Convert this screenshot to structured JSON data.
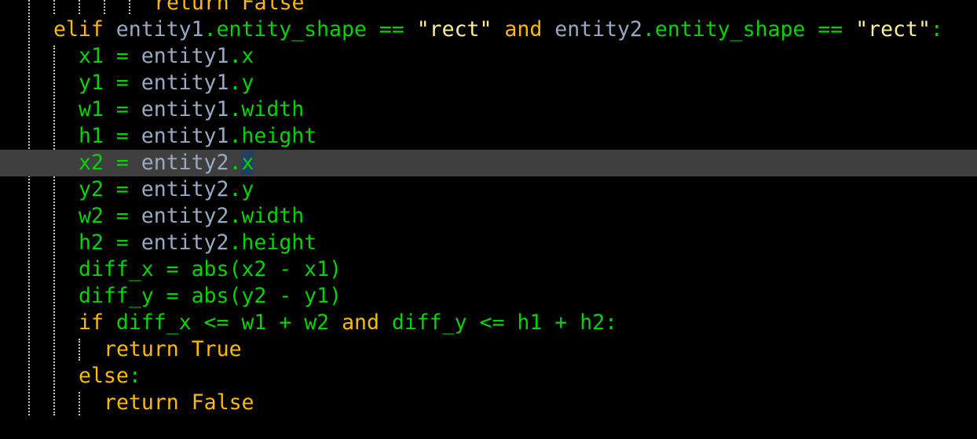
{
  "colors": {
    "background": "#000000",
    "current_line": "#3f3f3f",
    "keyword": "#ffb900",
    "identifier": "#98a9c2",
    "default": "#00d200",
    "string": "#ffee9c",
    "cursor": "#24405e"
  },
  "lines": [
    {
      "indent": 10,
      "current": false,
      "tokens": [
        {
          "t": "return",
          "c": "keyword"
        },
        {
          "t": " ",
          "c": "default"
        },
        {
          "t": "False",
          "c": "keyword"
        }
      ]
    },
    {
      "indent": 2,
      "current": false,
      "tokens": [
        {
          "t": "elif",
          "c": "keyword"
        },
        {
          "t": " ",
          "c": "default"
        },
        {
          "t": "entity1",
          "c": "identifier"
        },
        {
          "t": ".entity_shape == ",
          "c": "default"
        },
        {
          "t": "\"rect\"",
          "c": "string"
        },
        {
          "t": " ",
          "c": "default"
        },
        {
          "t": "and",
          "c": "keyword"
        },
        {
          "t": " ",
          "c": "default"
        },
        {
          "t": "entity2",
          "c": "identifier"
        },
        {
          "t": ".entity_shape == ",
          "c": "default"
        },
        {
          "t": "\"rect\"",
          "c": "string"
        },
        {
          "t": ":",
          "c": "default"
        }
      ]
    },
    {
      "indent": 4,
      "current": false,
      "tokens": [
        {
          "t": "x1 = ",
          "c": "default"
        },
        {
          "t": "entity1",
          "c": "identifier"
        },
        {
          "t": ".x",
          "c": "default"
        }
      ]
    },
    {
      "indent": 4,
      "current": false,
      "tokens": [
        {
          "t": "y1 = ",
          "c": "default"
        },
        {
          "t": "entity1",
          "c": "identifier"
        },
        {
          "t": ".y",
          "c": "default"
        }
      ]
    },
    {
      "indent": 4,
      "current": false,
      "tokens": [
        {
          "t": "w1 = ",
          "c": "default"
        },
        {
          "t": "entity1",
          "c": "identifier"
        },
        {
          "t": ".width",
          "c": "default"
        }
      ]
    },
    {
      "indent": 4,
      "current": false,
      "tokens": [
        {
          "t": "h1 = ",
          "c": "default"
        },
        {
          "t": "entity1",
          "c": "identifier"
        },
        {
          "t": ".height",
          "c": "default"
        }
      ]
    },
    {
      "indent": 4,
      "current": true,
      "tokens": [
        {
          "t": "x2 = ",
          "c": "default"
        },
        {
          "t": "entity2",
          "c": "identifier"
        },
        {
          "t": ".",
          "c": "default"
        },
        {
          "t": "x",
          "c": "default",
          "cursor": true
        }
      ]
    },
    {
      "indent": 4,
      "current": false,
      "tokens": [
        {
          "t": "y2 = ",
          "c": "default"
        },
        {
          "t": "entity2",
          "c": "identifier"
        },
        {
          "t": ".y",
          "c": "default"
        }
      ]
    },
    {
      "indent": 4,
      "current": false,
      "tokens": [
        {
          "t": "w2 = ",
          "c": "default"
        },
        {
          "t": "entity2",
          "c": "identifier"
        },
        {
          "t": ".width",
          "c": "default"
        }
      ]
    },
    {
      "indent": 4,
      "current": false,
      "tokens": [
        {
          "t": "h2 = ",
          "c": "default"
        },
        {
          "t": "entity2",
          "c": "identifier"
        },
        {
          "t": ".height",
          "c": "default"
        }
      ]
    },
    {
      "indent": 4,
      "current": false,
      "tokens": [
        {
          "t": "diff_x = abs(x2 - x1)",
          "c": "default"
        }
      ]
    },
    {
      "indent": 4,
      "current": false,
      "tokens": [
        {
          "t": "diff_y = abs(y2 - y1)",
          "c": "default"
        }
      ]
    },
    {
      "indent": 4,
      "current": false,
      "tokens": [
        {
          "t": "if",
          "c": "keyword"
        },
        {
          "t": " diff_x <= w1 + w2 ",
          "c": "default"
        },
        {
          "t": "and",
          "c": "keyword"
        },
        {
          "t": " diff_y <= h1 + h2:",
          "c": "default"
        }
      ]
    },
    {
      "indent": 6,
      "current": false,
      "tokens": [
        {
          "t": "return",
          "c": "keyword"
        },
        {
          "t": " ",
          "c": "default"
        },
        {
          "t": "True",
          "c": "keyword"
        }
      ]
    },
    {
      "indent": 4,
      "current": false,
      "tokens": [
        {
          "t": "else",
          "c": "keyword"
        },
        {
          "t": ":",
          "c": "default"
        }
      ]
    },
    {
      "indent": 6,
      "current": false,
      "tokens": [
        {
          "t": "return",
          "c": "keyword"
        },
        {
          "t": " ",
          "c": "default"
        },
        {
          "t": "False",
          "c": "keyword"
        }
      ]
    }
  ]
}
